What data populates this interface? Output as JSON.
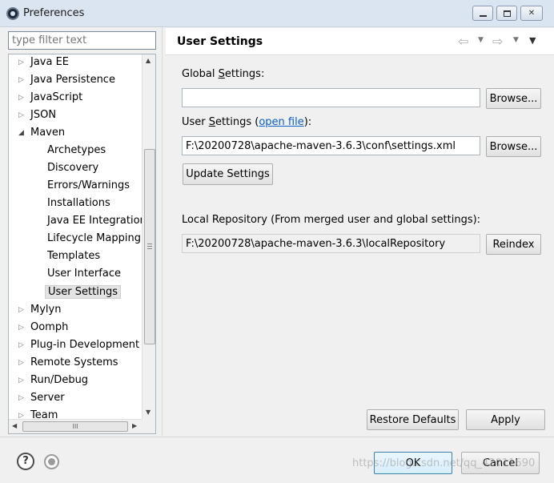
{
  "window": {
    "title": "Preferences"
  },
  "filter": {
    "placeholder": "type filter text"
  },
  "tree": {
    "items": [
      {
        "label": "Java EE"
      },
      {
        "label": "Java Persistence"
      },
      {
        "label": "JavaScript"
      },
      {
        "label": "JSON"
      },
      {
        "label": "Maven"
      },
      {
        "label": "Archetypes"
      },
      {
        "label": "Discovery"
      },
      {
        "label": "Errors/Warnings"
      },
      {
        "label": "Installations"
      },
      {
        "label": "Java EE Integration"
      },
      {
        "label": "Lifecycle Mapping"
      },
      {
        "label": "Templates"
      },
      {
        "label": "User Interface"
      },
      {
        "label": "User Settings"
      },
      {
        "label": "Mylyn"
      },
      {
        "label": "Oomph"
      },
      {
        "label": "Plug-in Development"
      },
      {
        "label": "Remote Systems"
      },
      {
        "label": "Run/Debug"
      },
      {
        "label": "Server"
      },
      {
        "label": "Team"
      }
    ],
    "selected": "User Settings",
    "hscroll_grip": "III"
  },
  "page": {
    "title": "User Settings",
    "global_settings_label_pre": "Global ",
    "global_settings_label_mnemonic": "S",
    "global_settings_label_post": "ettings:",
    "global_settings_value": "",
    "user_settings_label_pre": "User ",
    "user_settings_label_mnemonic": "S",
    "user_settings_label_mid": "ettings (",
    "open_file_link": "open file",
    "user_settings_label_post": "):",
    "user_settings_value": "F:\\20200728\\apache-maven-3.6.3\\conf\\settings.xml",
    "browse_label": "Browse...",
    "update_settings_label": "Update Settings",
    "local_repo_label": "Local Repository (From merged user and global settings):",
    "local_repo_value": "F:\\20200728\\apache-maven-3.6.3\\localRepository",
    "reindex_label": "Reindex",
    "restore_defaults_label": "Restore Defaults",
    "apply_label": "Apply"
  },
  "dialog": {
    "ok_label": "OK",
    "cancel_label": "Cancel",
    "watermark": "https://blog.csdn.net/qq_42011690"
  }
}
